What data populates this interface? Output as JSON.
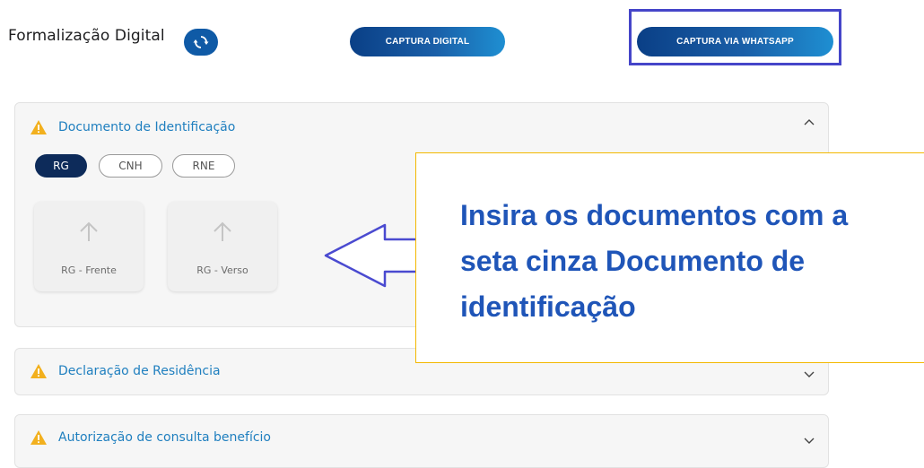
{
  "header": {
    "title": "Formalização Digital",
    "refresh_icon": "refresh-icon",
    "buttons": {
      "captura_digital": "CAPTURA DIGITAL",
      "captura_whatsapp": "CAPTURA VIA WHATSAPP"
    }
  },
  "sections": [
    {
      "title": "Documento de Identificação",
      "expanded": true,
      "status_icon": "warning-icon",
      "toggle_icon": "chevron-up-icon",
      "doc_types": [
        "RG",
        "CNH",
        "RNE"
      ],
      "selected_doc_type": "RG",
      "uploads": [
        {
          "label": "RG - Frente",
          "icon": "upload-arrow-icon"
        },
        {
          "label": "RG - Verso",
          "icon": "upload-arrow-icon"
        }
      ]
    },
    {
      "title": "Declaração de Residência",
      "expanded": false,
      "status_icon": "warning-icon",
      "toggle_icon": "chevron-down-icon"
    },
    {
      "title": "Autorização de consulta benefício",
      "expanded": false,
      "status_icon": "warning-icon",
      "toggle_icon": "chevron-down-icon"
    }
  ],
  "annotation": {
    "callout_text": "Insira os documentos com a seta cinza Documento de identificação",
    "highlight_target": "captura_whatsapp",
    "colors": {
      "highlight_border": "#4545c9",
      "callout_border": "#f3b800",
      "callout_text": "#1f55b8",
      "arrow": "#4a4ad0"
    }
  },
  "colors": {
    "primary_dark": "#0d2b5a",
    "primary": "#1a5fa8",
    "accent": "#1e8fd2",
    "warning": "#f2b01e",
    "section_title": "#1f7fbf"
  }
}
